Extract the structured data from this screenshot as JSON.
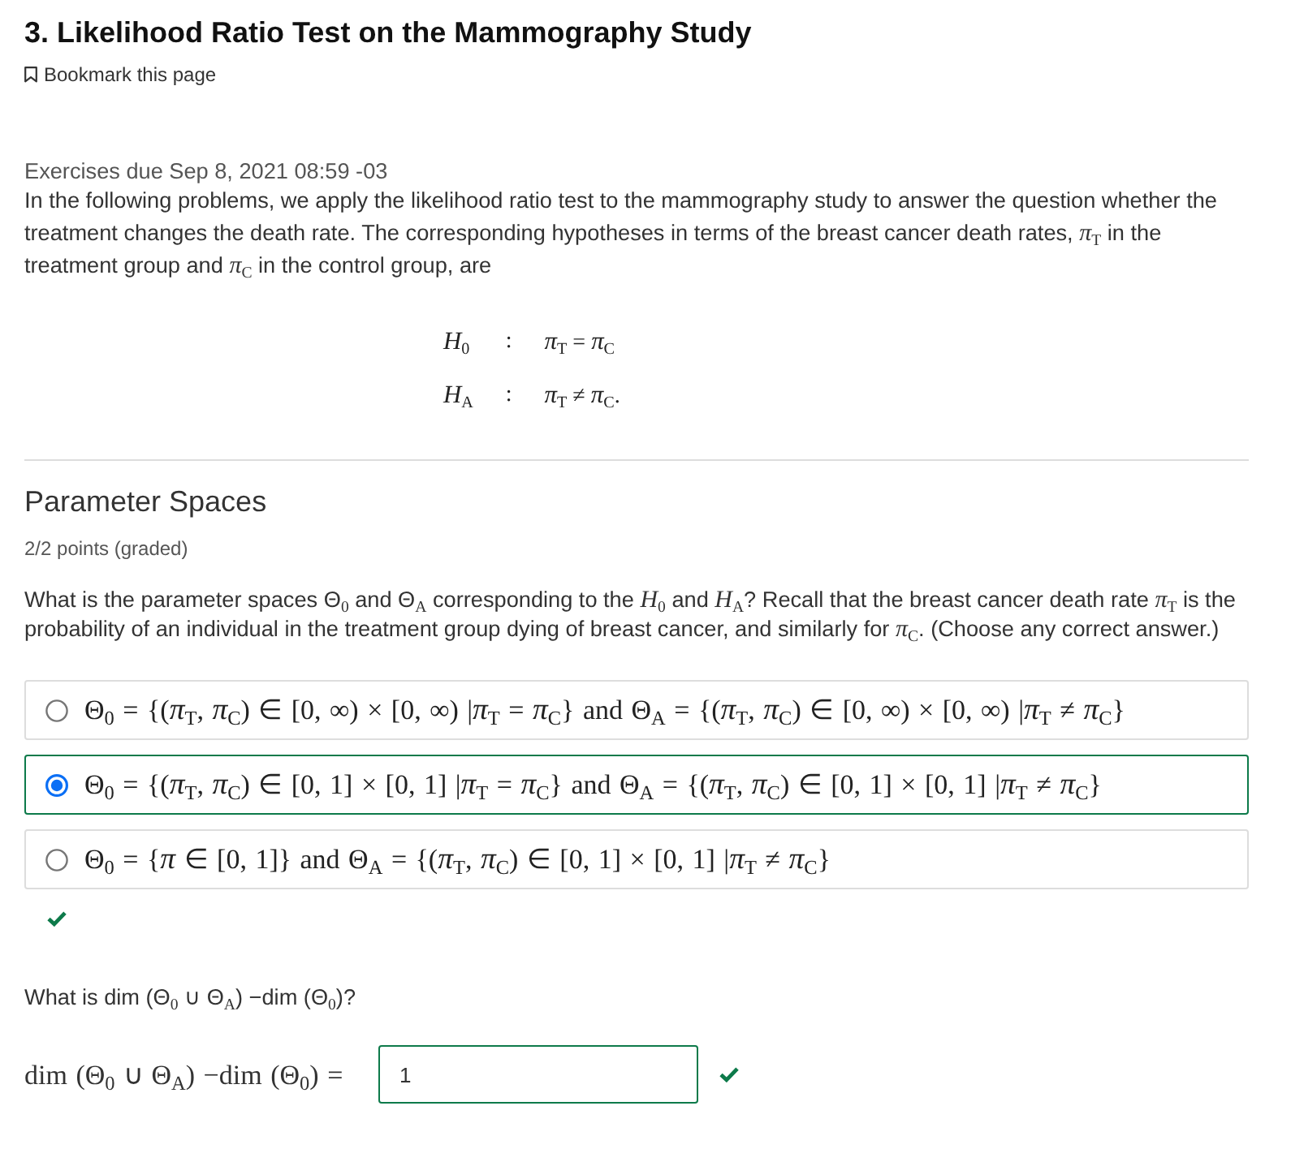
{
  "page": {
    "title": "3. Likelihood Ratio Test on the Mammography Study",
    "bookmark": {
      "label": "Bookmark this page"
    }
  },
  "intro": {
    "due": "Exercises due Sep 8, 2021 08:59 -03",
    "text": "In the following problems, we apply the likelihood ratio test to the mammography study to answer the question whether the treatment changes the death rate. The corresponding hypotheses in terms of the breast cancer death rates, *π*$_{T}$ in the treatment group and *π*$_{C}$ in the control group, are",
    "hypotheses": [
      {
        "lhs": "*H*$_{0}$",
        "sep": ":",
        "rhs": "*π*$_{T}$ = *π*$_{C}$"
      },
      {
        "lhs": "*H*$_{A}$",
        "sep": ":",
        "rhs": "*π*$_{T}$ ≠ *π*$_{C}$."
      }
    ]
  },
  "problem": {
    "title": "Parameter Spaces",
    "points": "2/2 points (graded)",
    "parts": [
      {
        "kind": "choice",
        "question": "What is the parameter spaces Θ$_{0}$ and Θ$_{A}$ corresponding to the *H*$_{0}$ and *H*$_{A}$? Recall that the breast cancer death rate *π*$_{T}$ is the probability of an individual in the treatment group dying of breast cancer, and similarly for *π*$_{C}$. (Choose any correct answer.)",
        "options": [
          {
            "text": "Θ$_{0}$ = {(*π*$_{T}$, *π*$_{C}$) ∈ [0, ∞) × [0, ∞) |*π*$_{T}$ = *π*$_{C}$} and Θ$_{A}$ = {(*π*$_{T}$, *π*$_{C}$) ∈ [0, ∞) × [0, ∞) |*π*$_{T}$ ≠ *π*$_{C}$}",
            "selected": false
          },
          {
            "text": "Θ$_{0}$ = {(*π*$_{T}$, *π*$_{C}$) ∈ [0, 1] × [0, 1] |*π*$_{T}$ = *π*$_{C}$} and Θ$_{A}$ = {(*π*$_{T}$, *π*$_{C}$) ∈ [0, 1] × [0, 1] |*π*$_{T}$ ≠ *π*$_{C}$}",
            "selected": true
          },
          {
            "text": "Θ$_{0}$ = {*π* ∈ [0, 1]} and Θ$_{A}$ = {(*π*$_{T}$, *π*$_{C}$) ∈ [0, 1] × [0, 1] |*π*$_{T}$ ≠ *π*$_{C}$}",
            "selected": false
          }
        ],
        "correct": true
      },
      {
        "kind": "numeric",
        "question": "What is dim (Θ$_{0}$ ∪ Θ$_{A}$) −dim (Θ$_{0}$)?",
        "label": "dim (Θ$_{0}$ ∪ Θ$_{A}$) −dim (Θ$_{0}$) =",
        "value": "1",
        "correct": true
      }
    ]
  }
}
